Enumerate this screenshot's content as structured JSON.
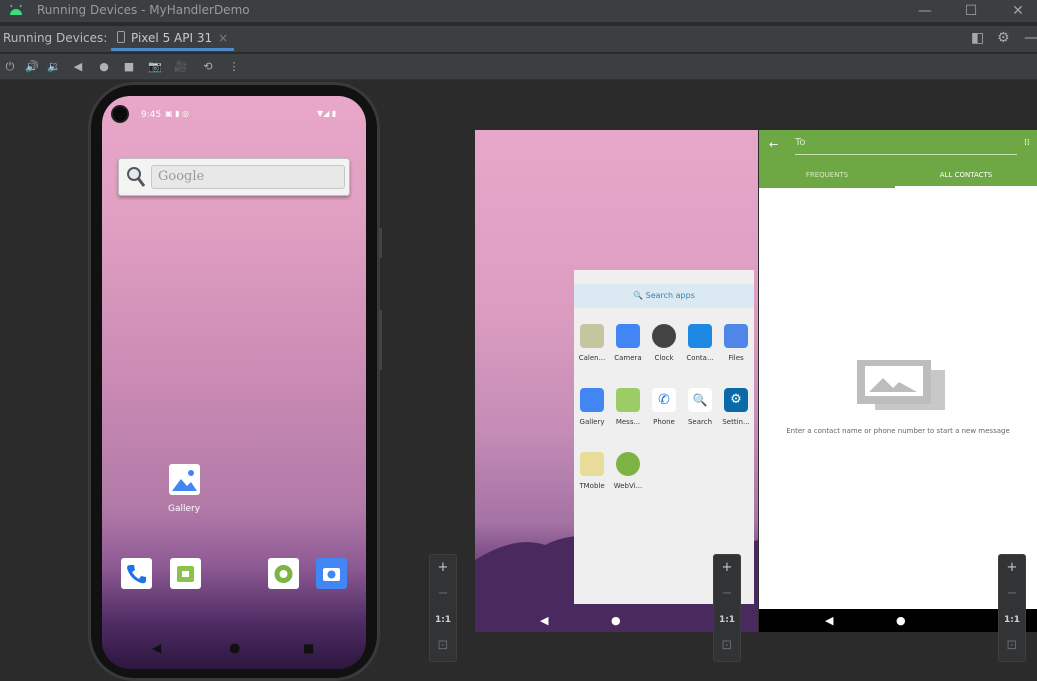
{
  "window": {
    "title": "Running Devices - MyHandlerDemo"
  },
  "tabbar": {
    "label": "Running Devices:",
    "tab_label": "Pixel 5 API 31",
    "tab_close": "×"
  },
  "phone1": {
    "time": "9:45",
    "search_placeholder": "Google",
    "gallery_label": "Gallery"
  },
  "phone2": {
    "search_label": "Search apps",
    "apps": [
      {
        "label": "Calen..."
      },
      {
        "label": "Camera"
      },
      {
        "label": "Clock"
      },
      {
        "label": "Conta..."
      },
      {
        "label": "Files"
      },
      {
        "label": "Gallery"
      },
      {
        "label": "Mess..."
      },
      {
        "label": "Phone"
      },
      {
        "label": "Search"
      },
      {
        "label": "Settin..."
      },
      {
        "label": "TMoble"
      },
      {
        "label": "WebVi..."
      }
    ]
  },
  "phone3": {
    "to_placeholder": "To",
    "tab_frequents": "FREQUENTS",
    "tab_all": "ALL CONTACTS",
    "empty_message": "Enter a contact name or phone number to start a new message"
  },
  "zoom": {
    "plus": "+",
    "minus": "−",
    "one_to_one": "1:1"
  },
  "colors": {
    "accent": "#4a88c7",
    "messages_green": "#6ea844"
  }
}
